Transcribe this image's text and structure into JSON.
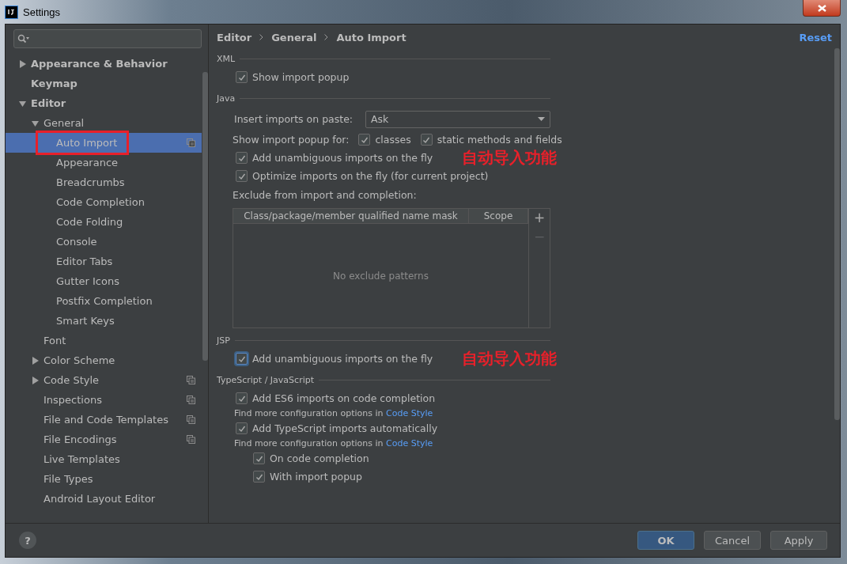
{
  "window": {
    "title": "Settings"
  },
  "sidebar": {
    "items": [
      {
        "label": "Appearance & Behavior",
        "expanded": false
      },
      {
        "label": "Keymap"
      },
      {
        "label": "Editor",
        "expanded": true,
        "children": [
          {
            "label": "General",
            "expanded": true,
            "children": [
              {
                "label": "Auto Import",
                "selected": true,
                "scoped": true,
                "marked": true
              },
              {
                "label": "Appearance",
                "selected": false
              },
              {
                "label": "Breadcrumbs",
                "selected": false
              },
              {
                "label": "Code Completion",
                "selected": false
              },
              {
                "label": "Code Folding",
                "selected": false
              },
              {
                "label": "Console",
                "selected": false
              },
              {
                "label": "Editor Tabs",
                "selected": false
              },
              {
                "label": "Gutter Icons",
                "selected": false
              },
              {
                "label": "Postfix Completion",
                "selected": false
              },
              {
                "label": "Smart Keys",
                "selected": false
              }
            ]
          },
          {
            "label": "Font",
            "selected": false
          },
          {
            "label": "Color Scheme",
            "expanded": false,
            "selected": false
          },
          {
            "label": "Code Style",
            "expanded": false,
            "selected": false,
            "scoped": true
          },
          {
            "label": "Inspections",
            "selected": false,
            "scoped": true
          },
          {
            "label": "File and Code Templates",
            "selected": false,
            "scoped": true
          },
          {
            "label": "File Encodings",
            "selected": false,
            "scoped": true
          },
          {
            "label": "Live Templates",
            "selected": false
          },
          {
            "label": "File Types",
            "selected": false
          },
          {
            "label": "Android Layout Editor",
            "selected": false
          }
        ]
      }
    ]
  },
  "breadcrumb": [
    "Editor",
    "General",
    "Auto Import"
  ],
  "reset": "Reset",
  "sections": [
    {
      "title": "XML",
      "rows": [
        {
          "kind": "checkbox",
          "label": "Show import popup",
          "checked": true
        }
      ]
    },
    {
      "title": "Java",
      "rows": [
        {
          "kind": "select",
          "label": "Insert imports on paste:",
          "value": "Ask"
        },
        {
          "kind": "group",
          "label": "Show import popup for:",
          "options": [
            {
              "label": "classes",
              "checked": true
            },
            {
              "label": "static methods and fields",
              "checked": true
            }
          ]
        },
        {
          "kind": "checkbox",
          "label": "Add unambiguous imports on the fly",
          "checked": true,
          "annotation": "自动导入功能"
        },
        {
          "kind": "checkbox",
          "label": "Optimize imports on the fly (for current project)",
          "checked": true
        },
        {
          "kind": "label",
          "label": "Exclude from import and completion:"
        },
        {
          "kind": "table",
          "columns": [
            "Class/package/member qualified name mask",
            "Scope"
          ],
          "empty_text": "No exclude patterns",
          "add": "+",
          "remove": "−"
        }
      ]
    },
    {
      "title": "JSP",
      "rows": [
        {
          "kind": "checkbox",
          "label": "Add unambiguous imports on the fly",
          "checked": true,
          "focused": true,
          "annotation": "自动导入功能"
        }
      ]
    },
    {
      "title": "TypeScript / JavaScript",
      "rows": [
        {
          "kind": "checkbox",
          "label": "Add ES6 imports on code completion",
          "checked": true
        },
        {
          "kind": "hint",
          "text": "Find more configuration options in",
          "link": "Code Style"
        },
        {
          "kind": "checkbox",
          "label": "Add TypeScript imports automatically",
          "checked": true
        },
        {
          "kind": "hint",
          "text": "Find more configuration options in",
          "link": "Code Style"
        },
        {
          "kind": "subcheckbox",
          "label": "On code completion",
          "checked": true
        },
        {
          "kind": "subcheckbox",
          "label": "With import popup",
          "checked": true
        }
      ]
    }
  ],
  "help": "?",
  "buttons": [
    {
      "label": "OK",
      "default": true
    },
    {
      "label": "Cancel",
      "default": false
    },
    {
      "label": "Apply",
      "default": false
    }
  ]
}
